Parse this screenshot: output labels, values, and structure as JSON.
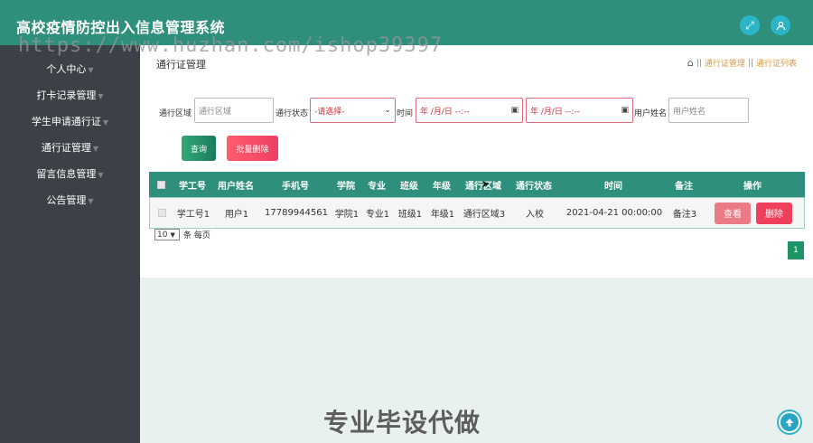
{
  "app": {
    "title": "高校疫情防控出入信息管理系统",
    "watermark": "https://www.huzhan.com/ishop39397",
    "fullscreen_icon": "expand-icon",
    "user_icon": "user-icon"
  },
  "sidebar": {
    "items": [
      {
        "label": "个人中心"
      },
      {
        "label": "打卡记录管理"
      },
      {
        "label": "学生申请通行证"
      },
      {
        "label": "通行证管理"
      },
      {
        "label": "留言信息管理"
      },
      {
        "label": "公告管理"
      }
    ]
  },
  "main": {
    "page_title": "通行证管理",
    "breadcrumb": [
      "通行证管理",
      "通行证列表"
    ],
    "filters": {
      "area_label": "通行区域",
      "area_placeholder": "通行区域",
      "status_label": "通行状态",
      "status_value": "-请选择-",
      "time_label": "时间",
      "date_start": "年 /月/日 --:--",
      "date_end": "年 /月/日 --:--",
      "username_label": "用户姓名",
      "username_placeholder": "用户姓名"
    },
    "buttons": {
      "query": "查询",
      "batch_delete": "批量删除"
    },
    "table": {
      "headers": [
        "学工号",
        "用户姓名",
        "手机号",
        "学院",
        "专业",
        "班级",
        "年级",
        "通行区域",
        "通行状态",
        "时间",
        "备注",
        "操作"
      ],
      "rows": [
        {
          "cells": [
            "学工号1",
            "用户1",
            "17789944561",
            "学院1",
            "专业1",
            "班级1",
            "年级1",
            "通行区域3",
            "入校",
            "2021-04-21 00:00:00",
            "备注3"
          ],
          "view_label": "查看",
          "delete_label": "删除"
        }
      ]
    },
    "pagination": {
      "page_size": "10",
      "page_size_suffix": "条 每页",
      "current_page": "1"
    }
  },
  "footer": {
    "promo_text": "专业毕设代做",
    "back_to_top_icon": "arrow-up-icon"
  },
  "colors": {
    "header": "#2e8f7c",
    "sidebar": "#3b4146",
    "query_button": "#2a9b70",
    "delete_button": "#ee3f5c"
  }
}
